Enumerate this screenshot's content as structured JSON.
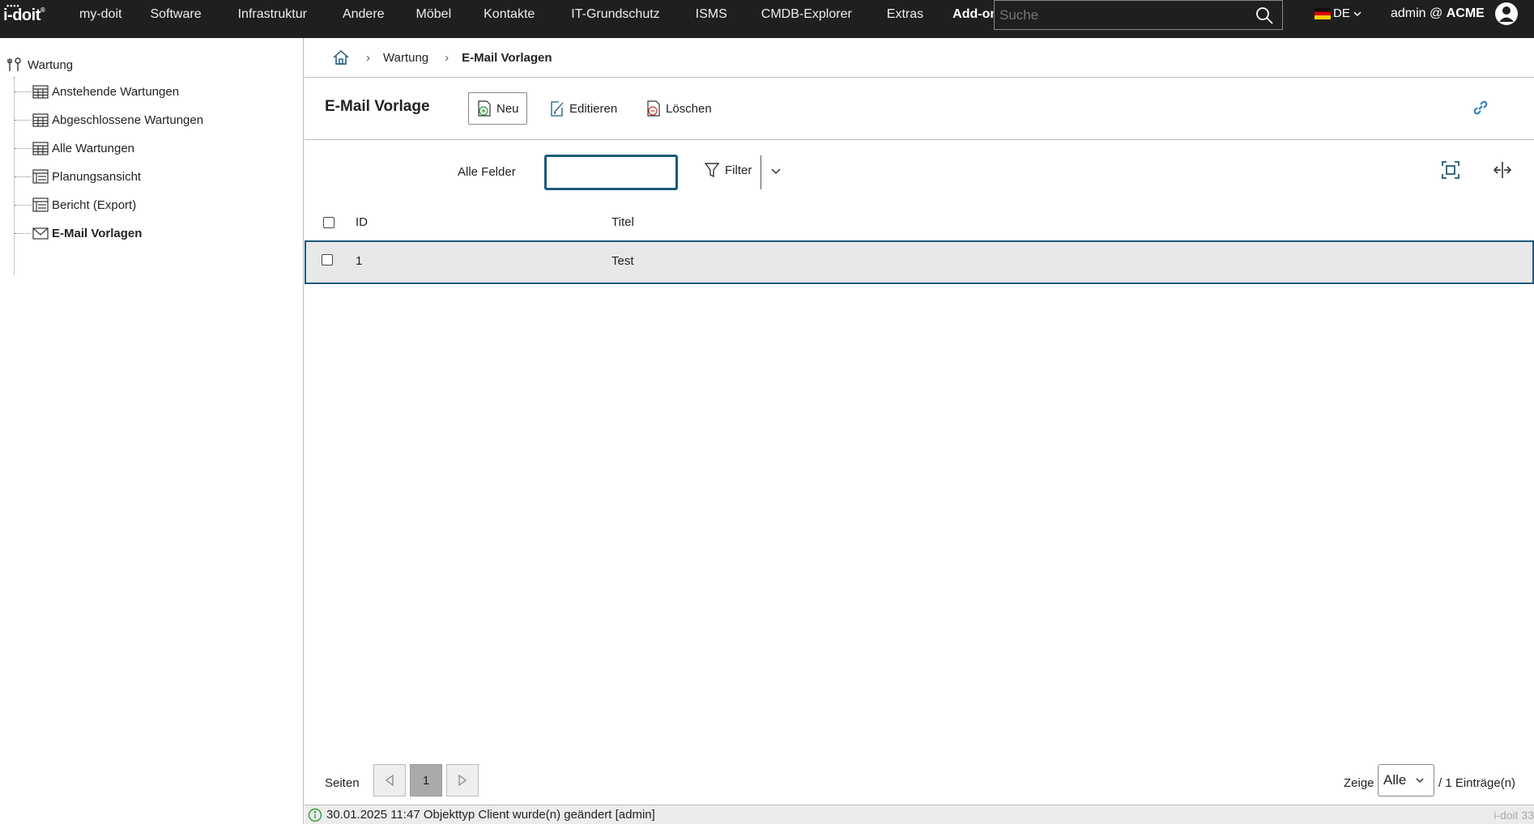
{
  "topbar": {
    "logo": "i-doit",
    "nav": [
      "my-doit",
      "Software",
      "Infrastruktur",
      "Andere",
      "Möbel",
      "Kontakte",
      "IT-Grundschutz",
      "ISMS",
      "CMDB-Explorer",
      "Extras",
      "Add-ons"
    ],
    "search_placeholder": "Suche",
    "language": "DE",
    "user_name": "admin @",
    "tenant": "ACME"
  },
  "sidebar": {
    "root": "Wartung",
    "items": [
      {
        "label": "Anstehende Wartungen",
        "icon": "calendar-icon"
      },
      {
        "label": "Abgeschlossene Wartungen",
        "icon": "calendar-icon"
      },
      {
        "label": "Alle Wartungen",
        "icon": "calendar-icon"
      },
      {
        "label": "Planungsansicht",
        "icon": "table-icon"
      },
      {
        "label": "Bericht (Export)",
        "icon": "table-icon"
      },
      {
        "label": "E-Mail Vorlagen",
        "icon": "envelope-icon"
      }
    ]
  },
  "breadcrumb": {
    "items": [
      "Wartung"
    ],
    "current": "E-Mail Vorlagen"
  },
  "toolbar": {
    "title": "E-Mail Vorlage",
    "new_label": "Neu",
    "edit_label": "Editieren",
    "delete_label": "Löschen"
  },
  "filter": {
    "label": "Alle Felder",
    "value": "",
    "button_label": "Filter"
  },
  "table": {
    "columns": [
      "ID",
      "Titel"
    ],
    "rows": [
      {
        "id": "1",
        "title": "Test"
      }
    ]
  },
  "pager": {
    "label": "Seiten",
    "current_page": "1",
    "show_label": "Zeige",
    "show_value": "Alle",
    "entries": "/ 1 Einträge(n)"
  },
  "status": {
    "message": "30.01.2025 11:47 Objekttyp Client wurde(n) geändert [admin]",
    "version": "i-doit 33"
  },
  "colors": {
    "topbar_bg": "#1f1f1f",
    "accent": "#1d5a7a",
    "link_icon": "#2a7ab5",
    "status_icon": "#2e9a3c"
  }
}
